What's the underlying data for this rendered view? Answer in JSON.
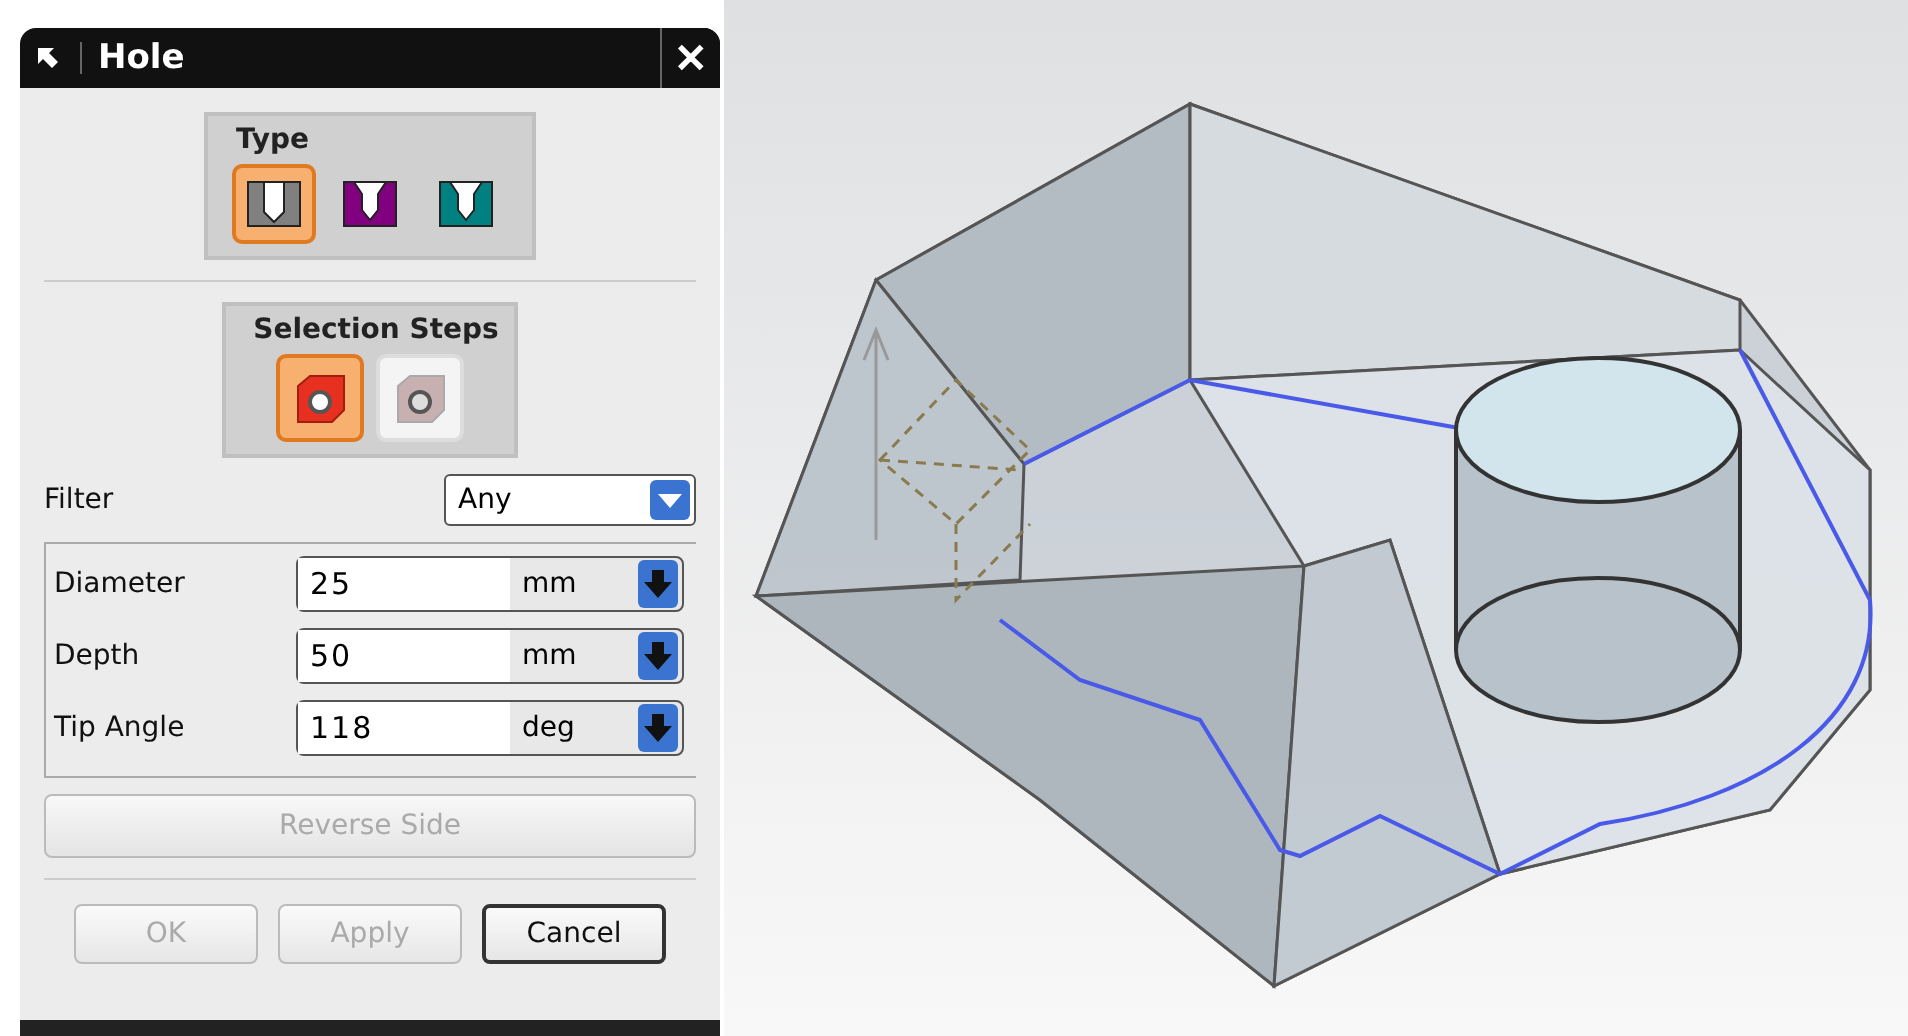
{
  "dialog": {
    "title": "Hole",
    "close": "✕"
  },
  "type_group": {
    "title": "Type",
    "items": [
      {
        "selected": true,
        "color": "#808080"
      },
      {
        "selected": false,
        "color": "#800080"
      },
      {
        "selected": false,
        "color": "#008080"
      }
    ]
  },
  "selection_steps": {
    "title": "Selection Steps",
    "items": [
      {
        "selected": true,
        "disabled": false
      },
      {
        "selected": false,
        "disabled": true
      }
    ]
  },
  "filter": {
    "label": "Filter",
    "value": "Any"
  },
  "parameters": [
    {
      "label": "Diameter",
      "value": "25",
      "unit": "mm"
    },
    {
      "label": "Depth",
      "value": "50",
      "unit": "mm"
    },
    {
      "label": "Tip Angle",
      "value": "118",
      "unit": "deg"
    }
  ],
  "reverse_side": {
    "label": "Reverse Side",
    "disabled": true
  },
  "buttons": [
    {
      "label": "OK",
      "disabled": true
    },
    {
      "label": "Apply",
      "disabled": true
    },
    {
      "label": "Cancel",
      "disabled": false
    }
  ]
}
